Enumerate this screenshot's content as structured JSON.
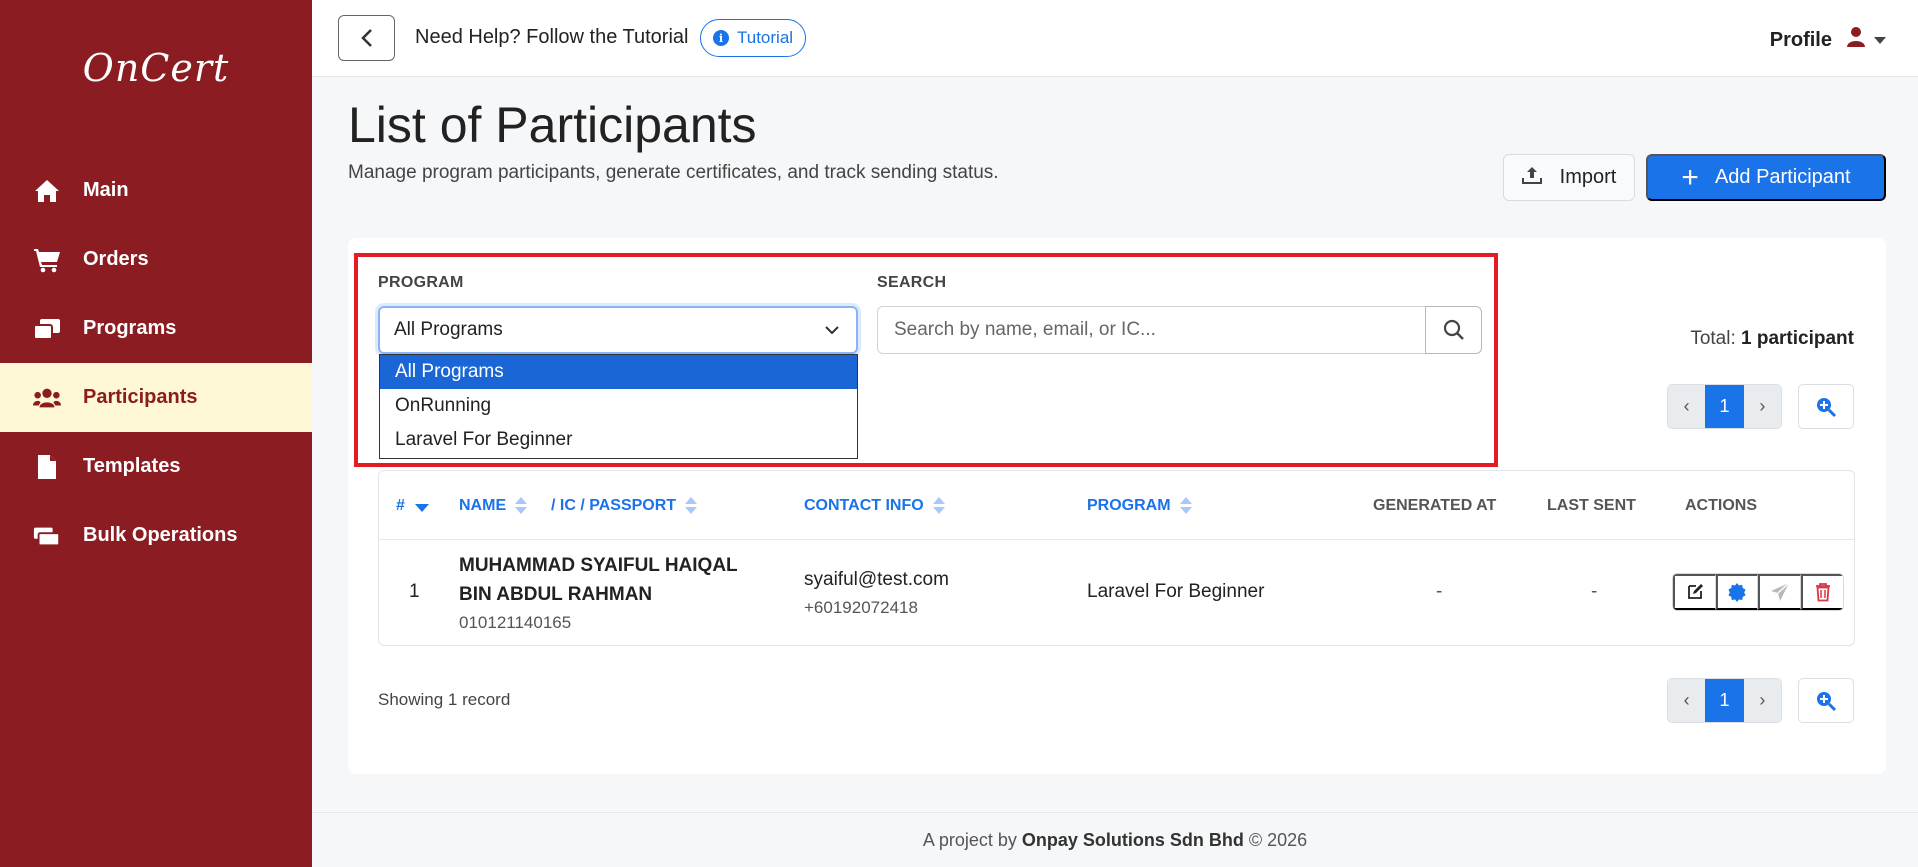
{
  "sidebar": {
    "logo": "OnCert",
    "items": [
      {
        "label": "Main",
        "icon": "home-icon"
      },
      {
        "label": "Orders",
        "icon": "cart-icon"
      },
      {
        "label": "Programs",
        "icon": "programs-icon"
      },
      {
        "label": "Participants",
        "icon": "users-icon",
        "active": true
      },
      {
        "label": "Templates",
        "icon": "file-icon"
      },
      {
        "label": "Bulk Operations",
        "icon": "bulk-icon"
      }
    ]
  },
  "topbar": {
    "help_text": "Need Help? Follow the Tutorial",
    "tutorial_label": "Tutorial",
    "profile_label": "Profile"
  },
  "header": {
    "title": "List of Participants",
    "subtitle": "Manage program participants, generate certificates, and track sending status.",
    "import_label": "Import",
    "add_label": "Add Participant"
  },
  "filters": {
    "program_label": "PROGRAM",
    "program_selected": "All Programs",
    "program_options": [
      "All Programs",
      "OnRunning",
      "Laravel For Beginner"
    ],
    "search_label": "SEARCH",
    "search_placeholder": "Search by name, email, or IC..."
  },
  "summary": {
    "total_prefix": "Total:",
    "total_value": "1 participant",
    "showing": "Showing 1 record"
  },
  "pager": {
    "prev": "‹",
    "current": "1",
    "next": "›"
  },
  "table": {
    "columns": {
      "num": "#",
      "name": "NAME",
      "ic": "/ IC / PASSPORT",
      "contact": "CONTACT INFO",
      "program": "PROGRAM",
      "generated": "GENERATED AT",
      "last_sent": "LAST SENT",
      "actions": "ACTIONS"
    },
    "rows": [
      {
        "num": "1",
        "name_line1": "MUHAMMAD SYAIFUL HAIQAL",
        "name_line2": "BIN ABDUL RAHMAN",
        "ic": "010121140165",
        "email": "syaiful@test.com",
        "phone": "+60192072418",
        "program": "Laravel For Beginner",
        "generated": "-",
        "last_sent": "-"
      }
    ]
  },
  "footer": {
    "prefix": "A project by",
    "company": "Onpay Solutions Sdn Bhd",
    "suffix": "© 2026"
  },
  "colors": {
    "sidebar": "#8b1d22",
    "accent": "#1a73e8",
    "active_nav_bg": "#fff8d6",
    "highlight": "#e31b23",
    "delete": "#dc3545"
  }
}
